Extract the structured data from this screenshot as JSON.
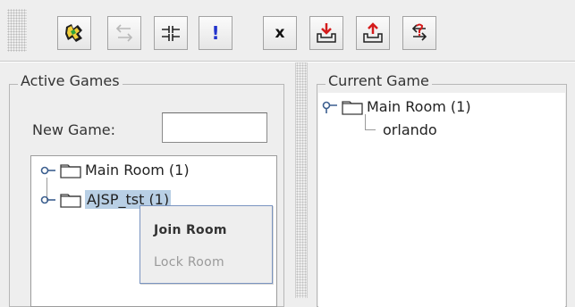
{
  "toolbar": {
    "buttons": [
      {
        "name": "logo-button",
        "icon": "game-logo-icon"
      },
      {
        "name": "back-button",
        "icon": "arrows-left-right-icon",
        "disabled": true
      },
      {
        "name": "split-button",
        "icon": "split-bars-icon"
      },
      {
        "name": "alert-button",
        "icon": "exclamation-icon",
        "glyph": "!"
      },
      {
        "name": "close-button",
        "icon": "x-icon",
        "glyph": "x"
      },
      {
        "name": "download-button",
        "icon": "download-tray-icon"
      },
      {
        "name": "upload-button",
        "icon": "upload-tray-icon"
      },
      {
        "name": "swap-button",
        "icon": "swap-arrows-icon"
      }
    ],
    "colors": {
      "accent_blue": "#2233cc",
      "accent_red": "#d41b1b"
    }
  },
  "left_panel": {
    "title": "Active Games",
    "new_game_label": "New Game:",
    "new_game_value": "",
    "new_game_placeholder": "",
    "tree": [
      {
        "label": "Main Room (1)",
        "selected": false
      },
      {
        "label": "AJSP_tst (1)",
        "selected": true
      }
    ]
  },
  "right_panel": {
    "title": "Current Game",
    "tree": {
      "label": "Main Room (1)",
      "children": [
        "orlando"
      ]
    }
  },
  "context_menu": {
    "items": [
      {
        "label": "Join Room",
        "enabled": true
      },
      {
        "label": "Lock Room",
        "enabled": false
      }
    ]
  },
  "colors": {
    "selection": "#b8cfe5",
    "menu_border": "#7a94c0"
  }
}
